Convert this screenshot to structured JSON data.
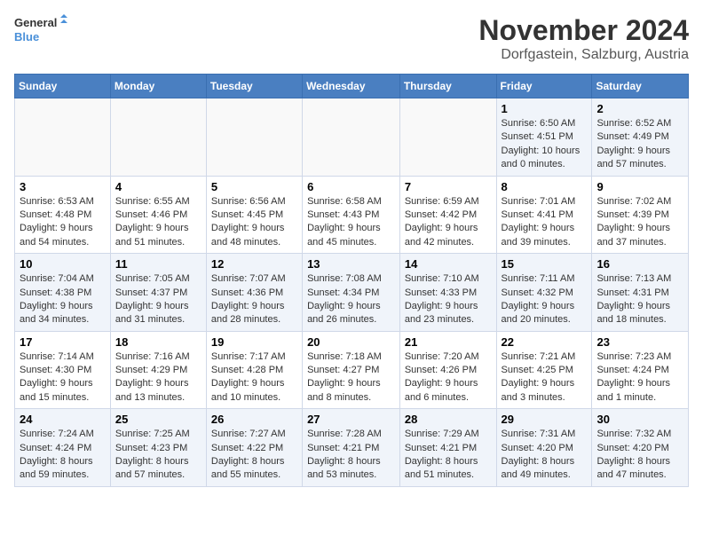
{
  "header": {
    "logo_line1": "General",
    "logo_line2": "Blue",
    "month": "November 2024",
    "location": "Dorfgastein, Salzburg, Austria"
  },
  "weekdays": [
    "Sunday",
    "Monday",
    "Tuesday",
    "Wednesday",
    "Thursday",
    "Friday",
    "Saturday"
  ],
  "weeks": [
    [
      {
        "day": "",
        "detail": ""
      },
      {
        "day": "",
        "detail": ""
      },
      {
        "day": "",
        "detail": ""
      },
      {
        "day": "",
        "detail": ""
      },
      {
        "day": "",
        "detail": ""
      },
      {
        "day": "1",
        "detail": "Sunrise: 6:50 AM\nSunset: 4:51 PM\nDaylight: 10 hours and 0 minutes."
      },
      {
        "day": "2",
        "detail": "Sunrise: 6:52 AM\nSunset: 4:49 PM\nDaylight: 9 hours and 57 minutes."
      }
    ],
    [
      {
        "day": "3",
        "detail": "Sunrise: 6:53 AM\nSunset: 4:48 PM\nDaylight: 9 hours and 54 minutes."
      },
      {
        "day": "4",
        "detail": "Sunrise: 6:55 AM\nSunset: 4:46 PM\nDaylight: 9 hours and 51 minutes."
      },
      {
        "day": "5",
        "detail": "Sunrise: 6:56 AM\nSunset: 4:45 PM\nDaylight: 9 hours and 48 minutes."
      },
      {
        "day": "6",
        "detail": "Sunrise: 6:58 AM\nSunset: 4:43 PM\nDaylight: 9 hours and 45 minutes."
      },
      {
        "day": "7",
        "detail": "Sunrise: 6:59 AM\nSunset: 4:42 PM\nDaylight: 9 hours and 42 minutes."
      },
      {
        "day": "8",
        "detail": "Sunrise: 7:01 AM\nSunset: 4:41 PM\nDaylight: 9 hours and 39 minutes."
      },
      {
        "day": "9",
        "detail": "Sunrise: 7:02 AM\nSunset: 4:39 PM\nDaylight: 9 hours and 37 minutes."
      }
    ],
    [
      {
        "day": "10",
        "detail": "Sunrise: 7:04 AM\nSunset: 4:38 PM\nDaylight: 9 hours and 34 minutes."
      },
      {
        "day": "11",
        "detail": "Sunrise: 7:05 AM\nSunset: 4:37 PM\nDaylight: 9 hours and 31 minutes."
      },
      {
        "day": "12",
        "detail": "Sunrise: 7:07 AM\nSunset: 4:36 PM\nDaylight: 9 hours and 28 minutes."
      },
      {
        "day": "13",
        "detail": "Sunrise: 7:08 AM\nSunset: 4:34 PM\nDaylight: 9 hours and 26 minutes."
      },
      {
        "day": "14",
        "detail": "Sunrise: 7:10 AM\nSunset: 4:33 PM\nDaylight: 9 hours and 23 minutes."
      },
      {
        "day": "15",
        "detail": "Sunrise: 7:11 AM\nSunset: 4:32 PM\nDaylight: 9 hours and 20 minutes."
      },
      {
        "day": "16",
        "detail": "Sunrise: 7:13 AM\nSunset: 4:31 PM\nDaylight: 9 hours and 18 minutes."
      }
    ],
    [
      {
        "day": "17",
        "detail": "Sunrise: 7:14 AM\nSunset: 4:30 PM\nDaylight: 9 hours and 15 minutes."
      },
      {
        "day": "18",
        "detail": "Sunrise: 7:16 AM\nSunset: 4:29 PM\nDaylight: 9 hours and 13 minutes."
      },
      {
        "day": "19",
        "detail": "Sunrise: 7:17 AM\nSunset: 4:28 PM\nDaylight: 9 hours and 10 minutes."
      },
      {
        "day": "20",
        "detail": "Sunrise: 7:18 AM\nSunset: 4:27 PM\nDaylight: 9 hours and 8 minutes."
      },
      {
        "day": "21",
        "detail": "Sunrise: 7:20 AM\nSunset: 4:26 PM\nDaylight: 9 hours and 6 minutes."
      },
      {
        "day": "22",
        "detail": "Sunrise: 7:21 AM\nSunset: 4:25 PM\nDaylight: 9 hours and 3 minutes."
      },
      {
        "day": "23",
        "detail": "Sunrise: 7:23 AM\nSunset: 4:24 PM\nDaylight: 9 hours and 1 minute."
      }
    ],
    [
      {
        "day": "24",
        "detail": "Sunrise: 7:24 AM\nSunset: 4:24 PM\nDaylight: 8 hours and 59 minutes."
      },
      {
        "day": "25",
        "detail": "Sunrise: 7:25 AM\nSunset: 4:23 PM\nDaylight: 8 hours and 57 minutes."
      },
      {
        "day": "26",
        "detail": "Sunrise: 7:27 AM\nSunset: 4:22 PM\nDaylight: 8 hours and 55 minutes."
      },
      {
        "day": "27",
        "detail": "Sunrise: 7:28 AM\nSunset: 4:21 PM\nDaylight: 8 hours and 53 minutes."
      },
      {
        "day": "28",
        "detail": "Sunrise: 7:29 AM\nSunset: 4:21 PM\nDaylight: 8 hours and 51 minutes."
      },
      {
        "day": "29",
        "detail": "Sunrise: 7:31 AM\nSunset: 4:20 PM\nDaylight: 8 hours and 49 minutes."
      },
      {
        "day": "30",
        "detail": "Sunrise: 7:32 AM\nSunset: 4:20 PM\nDaylight: 8 hours and 47 minutes."
      }
    ]
  ]
}
